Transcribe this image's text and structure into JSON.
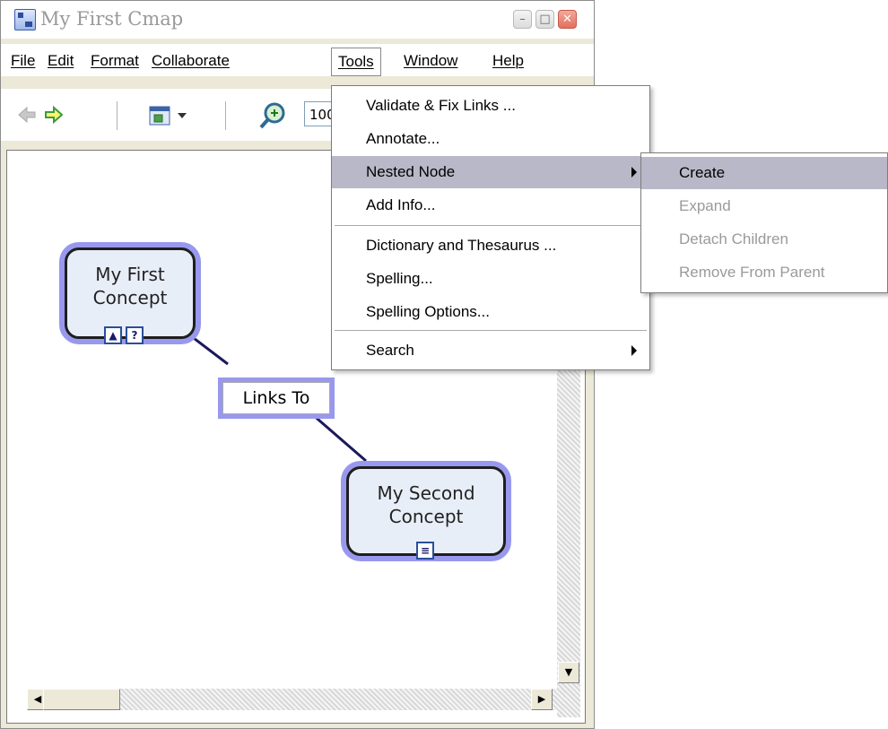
{
  "window": {
    "title": "My First Cmap"
  },
  "menubar": {
    "items": [
      {
        "label": "File"
      },
      {
        "label": "Edit"
      },
      {
        "label": "Format"
      },
      {
        "label": "Collaborate"
      },
      {
        "label": "Tools"
      },
      {
        "label": "Window"
      },
      {
        "label": "Help"
      }
    ]
  },
  "toolbar": {
    "zoom_value": "100"
  },
  "map": {
    "concepts": [
      {
        "label": "My First\nConcept"
      },
      {
        "label": "My Second\nConcept"
      }
    ],
    "link_label": "Links To"
  },
  "tools_menu": {
    "items": [
      {
        "label": "Validate & Fix Links ..."
      },
      {
        "label": "Annotate..."
      },
      {
        "label": "Nested Node"
      },
      {
        "label": "Add Info..."
      },
      {
        "label": "Dictionary and Thesaurus ..."
      },
      {
        "label": "Spelling..."
      },
      {
        "label": "Spelling Options..."
      },
      {
        "label": "Search"
      }
    ]
  },
  "nested_node_submenu": {
    "items": [
      {
        "label": "Create",
        "enabled": true
      },
      {
        "label": "Expand",
        "enabled": false
      },
      {
        "label": "Detach Children",
        "enabled": false
      },
      {
        "label": "Remove From Parent",
        "enabled": false
      }
    ]
  },
  "colors": {
    "node_glow": "#9898ee",
    "menu_highlight": "#b8b8c8",
    "link_line": "#1a1a5a"
  }
}
